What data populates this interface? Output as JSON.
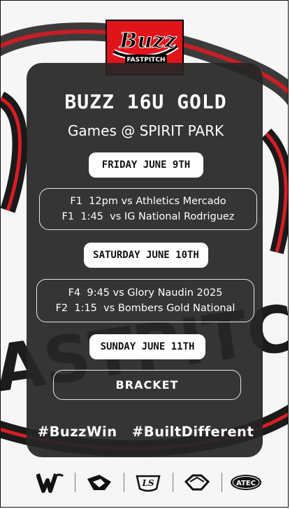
{
  "logo": {
    "brand": "Buzz",
    "tagline": "FASTPITCH",
    "brand_color": "#e2141b"
  },
  "header": {
    "title": "BUZZ 16U GOLD",
    "subtitle": "Games @ SPIRIT PARK"
  },
  "schedule": [
    {
      "day": "FRIDAY JUNE 9TH",
      "games": [
        "F1  12pm vs Athletics Mercado",
        "F1  1:45  vs IG National Rodriguez"
      ]
    },
    {
      "day": "SATURDAY JUNE 10TH",
      "games": [
        "F4  9:45 vs Glory Naudin 2025",
        "F2  1:15  vs Bombers Gold National"
      ]
    },
    {
      "day": "SUNDAY JUNE 11TH",
      "games": []
    }
  ],
  "bracket_label": "BRACKET",
  "hashtags": "#BuzzWin  #BuiltDifferent",
  "sponsors": [
    "wilson-logo-icon",
    "easton-logo-icon",
    "louisville-slugger-logo-icon",
    "evoshield-logo-icon",
    "atec-logo-icon"
  ],
  "colors": {
    "panel": "#262626",
    "accent_red": "#e2141b",
    "text": "#ffffff"
  }
}
